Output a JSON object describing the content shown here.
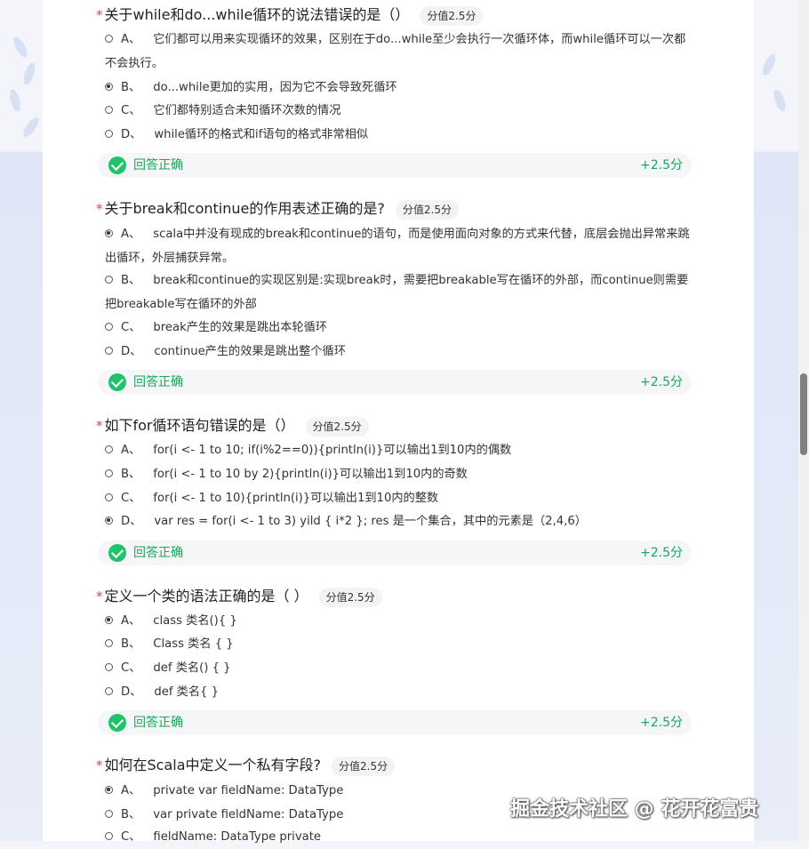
{
  "questions": [
    {
      "title": "关于while和do...while循环的说法错误的是（）",
      "score_tag": "分值2.5分",
      "options": [
        {
          "letter": "A、",
          "text": "它们都可以用来实现循环的效果，区别在于do...while至少会执行一次循环体，而while循环可以一次都不会执行。",
          "selected": false
        },
        {
          "letter": "B、",
          "text": "do...while更加的实用，因为它不会导致死循环",
          "selected": true
        },
        {
          "letter": "C、",
          "text": "它们都特别适合未知循环次数的情况",
          "selected": false
        },
        {
          "letter": "D、",
          "text": "while循环的格式和if语句的格式非常相似",
          "selected": false
        }
      ],
      "result": {
        "label": "回答正确",
        "score": "+2.5分"
      }
    },
    {
      "title": "关于break和continue的作用表述正确的是?",
      "score_tag": "分值2.5分",
      "options": [
        {
          "letter": "A、",
          "text": "scala中并没有现成的break和continue的语句，而是使用面向对象的方式来代替，底层会抛出异常来跳出循环，外层捕获异常。",
          "selected": true
        },
        {
          "letter": "B、",
          "text": "break和continue的实现区别是:实现break时，需要把breakable写在循环的外部，而continue则需要把breakable写在循环的外部",
          "selected": false
        },
        {
          "letter": "C、",
          "text": "break产生的效果是跳出本轮循环",
          "selected": false
        },
        {
          "letter": "D、",
          "text": "continue产生的效果是跳出整个循环",
          "selected": false
        }
      ],
      "result": {
        "label": "回答正确",
        "score": "+2.5分"
      }
    },
    {
      "title": "如下for循环语句错误的是（）",
      "score_tag": "分值2.5分",
      "options": [
        {
          "letter": "A、",
          "text": "for(i <- 1 to 10; if(i%2==0)){println(i)}可以输出1到10内的偶数",
          "selected": false
        },
        {
          "letter": "B、",
          "text": "for(i <- 1 to 10 by 2){println(i)}可以输出1到10内的奇数",
          "selected": false
        },
        {
          "letter": "C、",
          "text": "for(i <- 1 to 10){println(i)}可以输出1到10内的整数",
          "selected": false
        },
        {
          "letter": "D、",
          "text": "var res = for(i <- 1 to 3) yild { i*2 }; res 是一个集合，其中的元素是（2,4,6）",
          "selected": true
        }
      ],
      "result": {
        "label": "回答正确",
        "score": "+2.5分"
      }
    },
    {
      "title": "定义一个类的语法正确的是（ ）",
      "score_tag": "分值2.5分",
      "options": [
        {
          "letter": "A、",
          "text": "class 类名(){ }",
          "selected": true
        },
        {
          "letter": "B、",
          "text": "Class 类名 { }",
          "selected": false
        },
        {
          "letter": "C、",
          "text": "def 类名() { }",
          "selected": false
        },
        {
          "letter": "D、",
          "text": "def 类名{ }",
          "selected": false
        }
      ],
      "result": {
        "label": "回答正确",
        "score": "+2.5分"
      }
    },
    {
      "title": "如何在Scala中定义一个私有字段?",
      "score_tag": "分值2.5分",
      "options": [
        {
          "letter": "A、",
          "text": "private var fieldName: DataType",
          "selected": true
        },
        {
          "letter": "B、",
          "text": "var private fieldName: DataType",
          "selected": false
        },
        {
          "letter": "C、",
          "text": "fieldName: DataType private",
          "selected": false
        }
      ]
    }
  ],
  "watermark": "掘金技术社区 @ 花开花富贵",
  "colors": {
    "correct": "#1ec36a",
    "required_star": "#e64545"
  }
}
